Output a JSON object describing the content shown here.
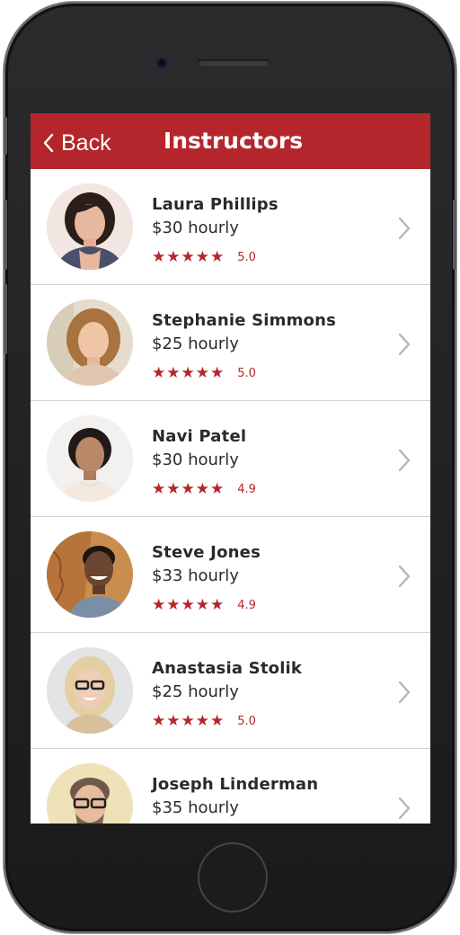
{
  "nav": {
    "back_label": "Back",
    "title": "Instructors"
  },
  "colors": {
    "accent": "#b4262b",
    "text": "#2a2a2a",
    "divider": "#d2d2d6",
    "chevron": "#b6b6bb"
  },
  "instructors": [
    {
      "name": "Laura Phillips",
      "rate": "$30 hourly",
      "stars": "★★★★★",
      "score": "5.0"
    },
    {
      "name": "Stephanie Simmons",
      "rate": "$25 hourly",
      "stars": "★★★★★",
      "score": "5.0"
    },
    {
      "name": "Navi Patel",
      "rate": "$30 hourly",
      "stars": "★★★★★",
      "score": "4.9"
    },
    {
      "name": "Steve Jones",
      "rate": "$33 hourly",
      "stars": "★★★★★",
      "score": "4.9"
    },
    {
      "name": "Anastasia Stolik",
      "rate": "$25 hourly",
      "stars": "★★★★★",
      "score": "5.0"
    },
    {
      "name": "Joseph Linderman",
      "rate": "$35 hourly",
      "stars": "★★★★★",
      "score": ""
    }
  ]
}
